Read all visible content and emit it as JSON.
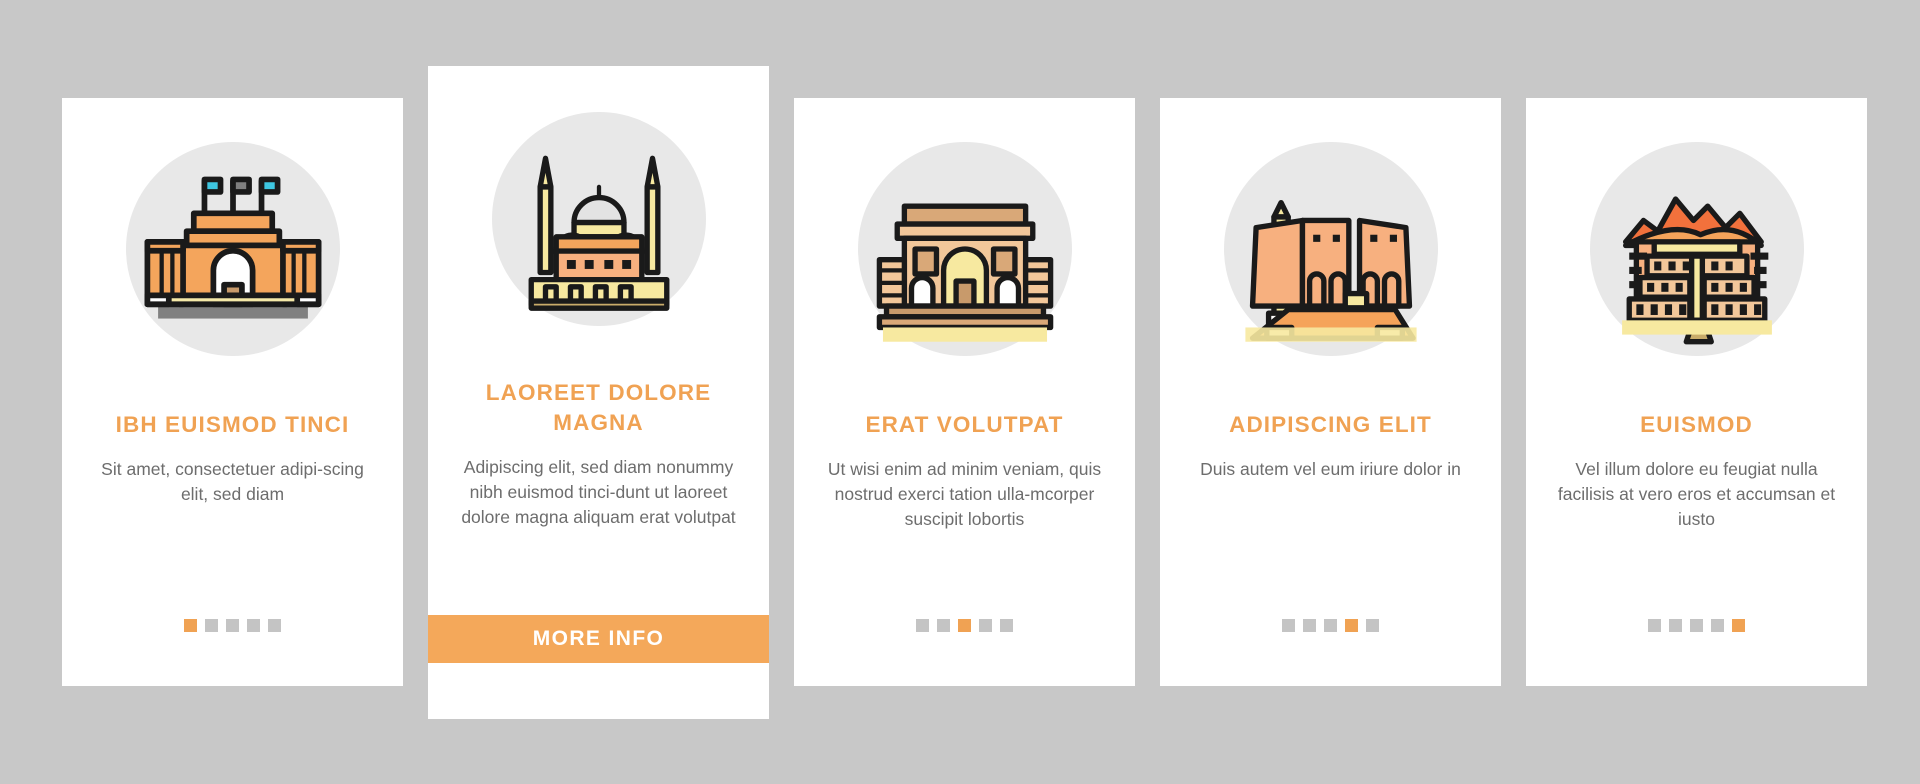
{
  "meta": {
    "background_color": "#c8c8c8",
    "card_color": "#ffffff",
    "accent_color": "#f0a253",
    "button_color": "#f4a85a",
    "body_text_color": "#6d6d6d",
    "dot_inactive_color": "#c4c4c4",
    "icon_disc_color": "#e8e8e8"
  },
  "cards": [
    {
      "icon_name": "triumphal-arch-building-icon",
      "title": "IBH EUISMOD TINCI",
      "body": "Sit amet, consectetuer adipi-scing elit, sed diam",
      "dots": [
        "active",
        "inactive",
        "inactive",
        "inactive",
        "inactive"
      ],
      "featured": false
    },
    {
      "icon_name": "mosque-with-minarets-icon",
      "title": "LAOREET DOLORE MAGNA",
      "body": "Adipiscing elit, sed diam nonummy nibh euismod tinci-dunt ut laoreet dolore magna aliquam erat volutpat",
      "dots": [
        "inactive",
        "active",
        "inactive",
        "inactive",
        "inactive"
      ],
      "featured": true,
      "button_label": "MORE INFO"
    },
    {
      "icon_name": "arc-de-triomphe-icon",
      "title": "ERAT VOLUTPAT",
      "body": "Ut wisi enim ad minim veniam, quis nostrud exerci tation ulla-mcorper suscipit lobortis",
      "dots": [
        "inactive",
        "inactive",
        "active",
        "inactive",
        "inactive"
      ],
      "featured": false
    },
    {
      "icon_name": "egyptian-temple-obelisk-icon",
      "title": "ADIPISCING ELIT",
      "body": "Duis autem vel eum iriure dolor in",
      "dots": [
        "inactive",
        "inactive",
        "inactive",
        "active",
        "inactive"
      ],
      "featured": false
    },
    {
      "icon_name": "potala-palace-mountain-icon",
      "title": "EUISMOD",
      "body": "Vel illum dolore eu feugiat nulla facilisis at vero eros et accumsan et iusto",
      "dots": [
        "inactive",
        "inactive",
        "inactive",
        "inactive",
        "active"
      ],
      "featured": false
    }
  ]
}
